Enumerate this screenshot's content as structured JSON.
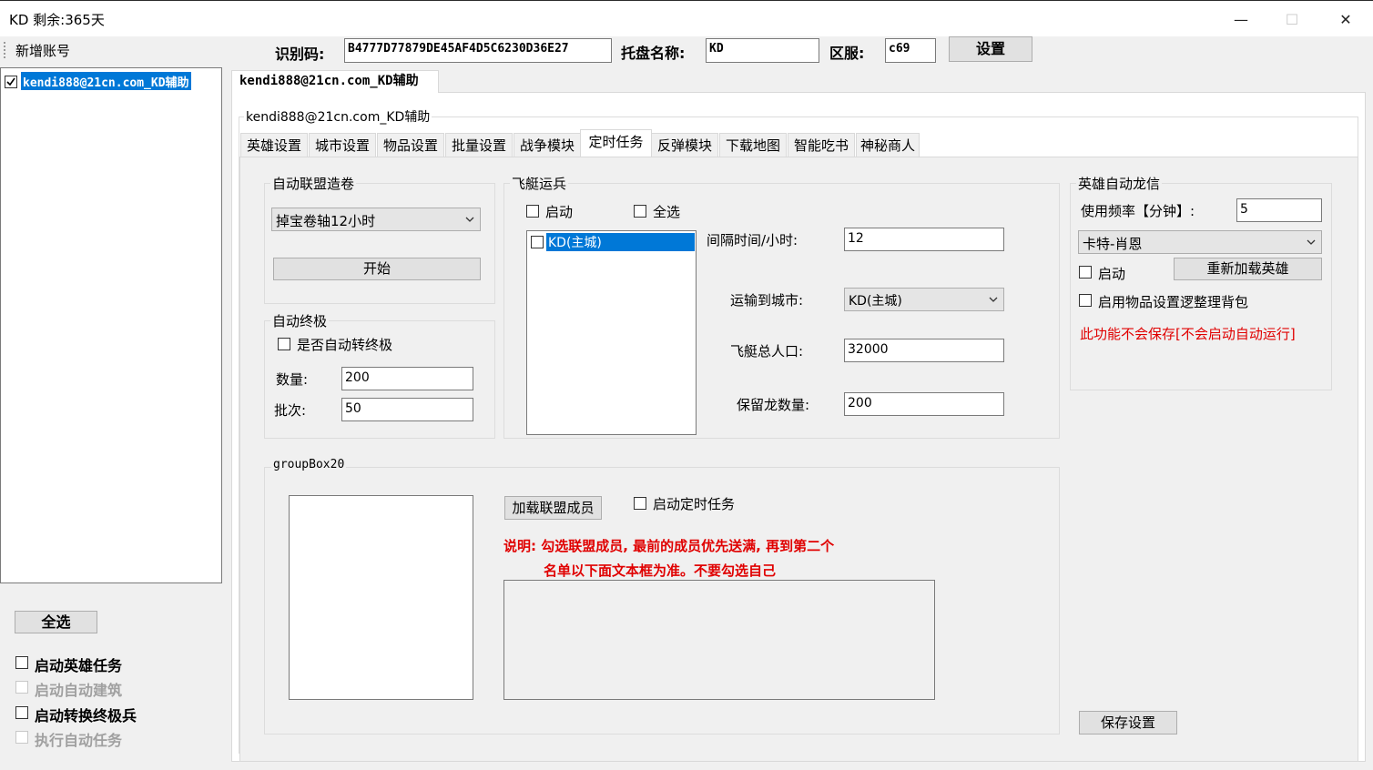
{
  "window": {
    "title": "KD 剩余:365天",
    "minimize": "—",
    "maximize": "☐",
    "close": "✕"
  },
  "toolbar": {
    "add_account": "新增账号",
    "id_label": "识别码:",
    "id_value": "B4777D77879DE45AF4D5C6230D36E27",
    "host_label": "托盘名称:",
    "host_value": "KD",
    "server_label": "区服:",
    "server_value": "c69",
    "set_button": "设置"
  },
  "accounts": {
    "items": [
      {
        "label": "kendi888@21cn.com_KD辅助",
        "checked": true
      }
    ]
  },
  "left_bottom": {
    "select_all": "全选",
    "options": [
      {
        "label": "启动英雄任务",
        "enabled": true
      },
      {
        "label": "启动自动建筑",
        "enabled": false
      },
      {
        "label": "启动转换终极兵",
        "enabled": true
      },
      {
        "label": "执行自动任务",
        "enabled": false
      }
    ]
  },
  "account_tab": "kendi888@21cn.com_KD辅助",
  "account_group_title": "kendi888@21cn.com_KD辅助",
  "tabs": [
    "英雄设置",
    "城市设置",
    "物品设置",
    "批量设置",
    "战争模块",
    "定时任务",
    "反弹模块",
    "下载地图",
    "智能吃书",
    "神秘商人"
  ],
  "active_tab": "定时任务",
  "alliance_scroll": {
    "title": "自动联盟造卷",
    "selected": "掉宝卷轴12小时",
    "start_button": "开始"
  },
  "auto_ultimate": {
    "title": "自动终极",
    "auto_convert_label": "是否自动转终极",
    "qty_label": "数量:",
    "qty_value": "200",
    "batch_label": "批次:",
    "batch_value": "50"
  },
  "airship": {
    "title": "飞艇运兵",
    "start_label": "启动",
    "select_all_label": "全选",
    "cities": [
      {
        "label": "KD(主城)",
        "selected": true
      }
    ],
    "interval_label": "间隔时间/小时:",
    "interval_value": "12",
    "dest_label": "运输到城市:",
    "dest_value": "KD(主城)",
    "population_label": "飞艇总人口:",
    "population_value": "32000",
    "reserve_label": "保留龙数量:",
    "reserve_value": "200"
  },
  "hero_dragon": {
    "title": "英雄自动龙信",
    "freq_label": "使用频率【分钟】:",
    "freq_value": "5",
    "hero_selected": "卡特-肖恩",
    "start_label": "启动",
    "reload_button": "重新加载英雄",
    "use_items_label": "启用物品设置逻整理背包",
    "warning": "此功能不会保存[不会启动自动运行]"
  },
  "group20": {
    "title": "groupBox20",
    "load_members_button": "加载联盟成员",
    "start_timer_label": "启动定时任务",
    "note_line1": "说明: 勾选联盟成员, 最前的成员优先送满, 再到第二个",
    "note_line2": "名单以下面文本框为准。不要勾选自己"
  },
  "save_button": "保存设置",
  "colors": {
    "selection": "#0078d7",
    "warning_red": "#e00000"
  }
}
